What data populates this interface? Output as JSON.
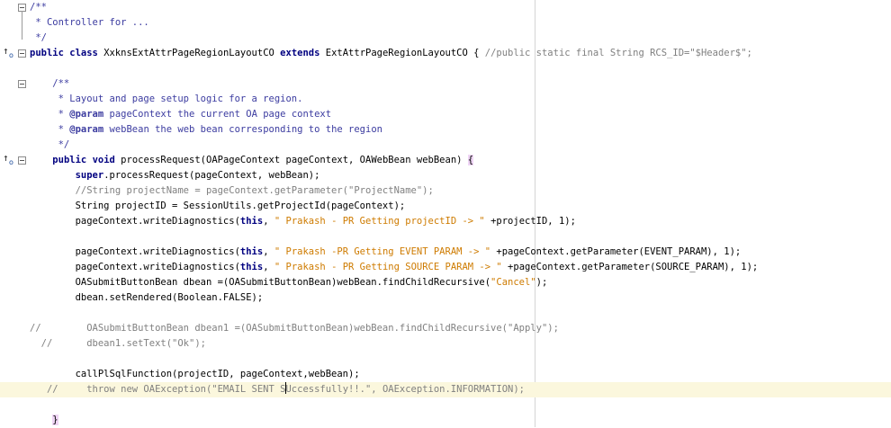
{
  "editor": {
    "lines": [
      {
        "tokens": [
          {
            "t": "/**",
            "c": "doc"
          }
        ]
      },
      {
        "tokens": [
          {
            "t": " * Controller for ...",
            "c": "doc"
          }
        ]
      },
      {
        "tokens": [
          {
            "t": " */",
            "c": "doc"
          }
        ]
      },
      {
        "tokens": [
          {
            "t": "public",
            "c": "kw"
          },
          {
            "t": " ",
            "c": ""
          },
          {
            "t": "class",
            "c": "kw"
          },
          {
            "t": " XxknsExtAttrPageRegionLayoutCO ",
            "c": ""
          },
          {
            "t": "extends",
            "c": "kw"
          },
          {
            "t": " ExtAttrPageRegionLayoutCO { ",
            "c": ""
          },
          {
            "t": "//public static final String RCS_ID=\"$Header$\";",
            "c": "cm"
          }
        ]
      },
      {
        "tokens": []
      },
      {
        "tokens": [
          {
            "t": "    /**",
            "c": "doc"
          }
        ]
      },
      {
        "tokens": [
          {
            "t": "     * Layout and page setup logic for a region.",
            "c": "doc"
          }
        ]
      },
      {
        "tokens": [
          {
            "t": "     * ",
            "c": "doc"
          },
          {
            "t": "@param",
            "c": "doctag"
          },
          {
            "t": " pageContext the current OA page context",
            "c": "doc"
          }
        ]
      },
      {
        "tokens": [
          {
            "t": "     * ",
            "c": "doc"
          },
          {
            "t": "@param",
            "c": "doctag"
          },
          {
            "t": " webBean the web bean corresponding to the region",
            "c": "doc"
          }
        ]
      },
      {
        "tokens": [
          {
            "t": "     */",
            "c": "doc"
          }
        ]
      },
      {
        "tokens": [
          {
            "t": "    ",
            "c": ""
          },
          {
            "t": "public",
            "c": "kw"
          },
          {
            "t": " ",
            "c": ""
          },
          {
            "t": "void",
            "c": "kw"
          },
          {
            "t": " processRequest(OAPageContext pageContext, OAWebBean webBean) ",
            "c": ""
          },
          {
            "t": "{",
            "c": "brace-hl"
          }
        ]
      },
      {
        "tokens": [
          {
            "t": "        ",
            "c": ""
          },
          {
            "t": "super",
            "c": "kw"
          },
          {
            "t": ".processRequest(pageContext, webBean);",
            "c": ""
          }
        ]
      },
      {
        "tokens": [
          {
            "t": "        //String projectName = pageContext.getParameter(\"ProjectName\");",
            "c": "cm"
          }
        ]
      },
      {
        "tokens": [
          {
            "t": "        String projectID = SessionUtils.getProjectId(pageContext);",
            "c": ""
          }
        ]
      },
      {
        "tokens": [
          {
            "t": "        pageContext.writeDiagnostics(",
            "c": ""
          },
          {
            "t": "this",
            "c": "kw"
          },
          {
            "t": ", ",
            "c": ""
          },
          {
            "t": "\" Prakash - PR Getting projectID -> \"",
            "c": "str"
          },
          {
            "t": " +projectID, ",
            "c": ""
          },
          {
            "t": "1",
            "c": "num"
          },
          {
            "t": ");",
            "c": ""
          }
        ]
      },
      {
        "tokens": []
      },
      {
        "tokens": [
          {
            "t": "        pageContext.writeDiagnostics(",
            "c": ""
          },
          {
            "t": "this",
            "c": "kw"
          },
          {
            "t": ", ",
            "c": ""
          },
          {
            "t": "\" Prakash -PR Getting EVENT PARAM -> \"",
            "c": "str"
          },
          {
            "t": " +pageContext.getParameter(EVENT_PARAM), ",
            "c": ""
          },
          {
            "t": "1",
            "c": "num"
          },
          {
            "t": ");",
            "c": ""
          }
        ]
      },
      {
        "tokens": [
          {
            "t": "        pageContext.writeDiagnostics(",
            "c": ""
          },
          {
            "t": "this",
            "c": "kw"
          },
          {
            "t": ", ",
            "c": ""
          },
          {
            "t": "\" Prakash - PR Getting SOURCE PARAM -> \"",
            "c": "str"
          },
          {
            "t": " +pageContext.getParameter(SOURCE_PARAM), ",
            "c": ""
          },
          {
            "t": "1",
            "c": "num"
          },
          {
            "t": ");",
            "c": ""
          }
        ]
      },
      {
        "tokens": [
          {
            "t": "        OASubmitButtonBean dbean =(OASubmitButtonBean)webBean.findChildRecursive(",
            "c": ""
          },
          {
            "t": "\"Cancel\"",
            "c": "str"
          },
          {
            "t": ");",
            "c": ""
          }
        ]
      },
      {
        "tokens": [
          {
            "t": "        dbean.setRendered(Boolean.FALSE);",
            "c": ""
          }
        ]
      },
      {
        "tokens": []
      },
      {
        "tokens": [
          {
            "t": "//        OASubmitButtonBean dbean1 =(OASubmitButtonBean)webBean.findChildRecursive(\"Apply\");",
            "c": "cm"
          }
        ]
      },
      {
        "tokens": [
          {
            "t": "  //      dbean1.setText(\"Ok\");",
            "c": "cm"
          }
        ]
      },
      {
        "tokens": []
      },
      {
        "tokens": [
          {
            "t": "        callPlSqlFunction(projectID, pageContext,webBean);",
            "c": ""
          }
        ]
      },
      {
        "tokens": [
          {
            "t": "   //     throw new OAException(\"EMAIL SENT S",
            "c": "cm"
          },
          {
            "t": "",
            "c": "caret"
          },
          {
            "t": "Uccessfully!!.\", OAException.INFORMATION);",
            "c": "cm"
          }
        ],
        "current": true
      },
      {
        "tokens": []
      },
      {
        "tokens": [
          {
            "t": "    ",
            "c": ""
          },
          {
            "t": "}",
            "c": "brace-hl"
          }
        ]
      }
    ]
  },
  "gutter": {
    "fold_lines": [
      0,
      3,
      5,
      10
    ],
    "override_lines": [
      3,
      10
    ],
    "override_icon": "override-method-icon"
  }
}
